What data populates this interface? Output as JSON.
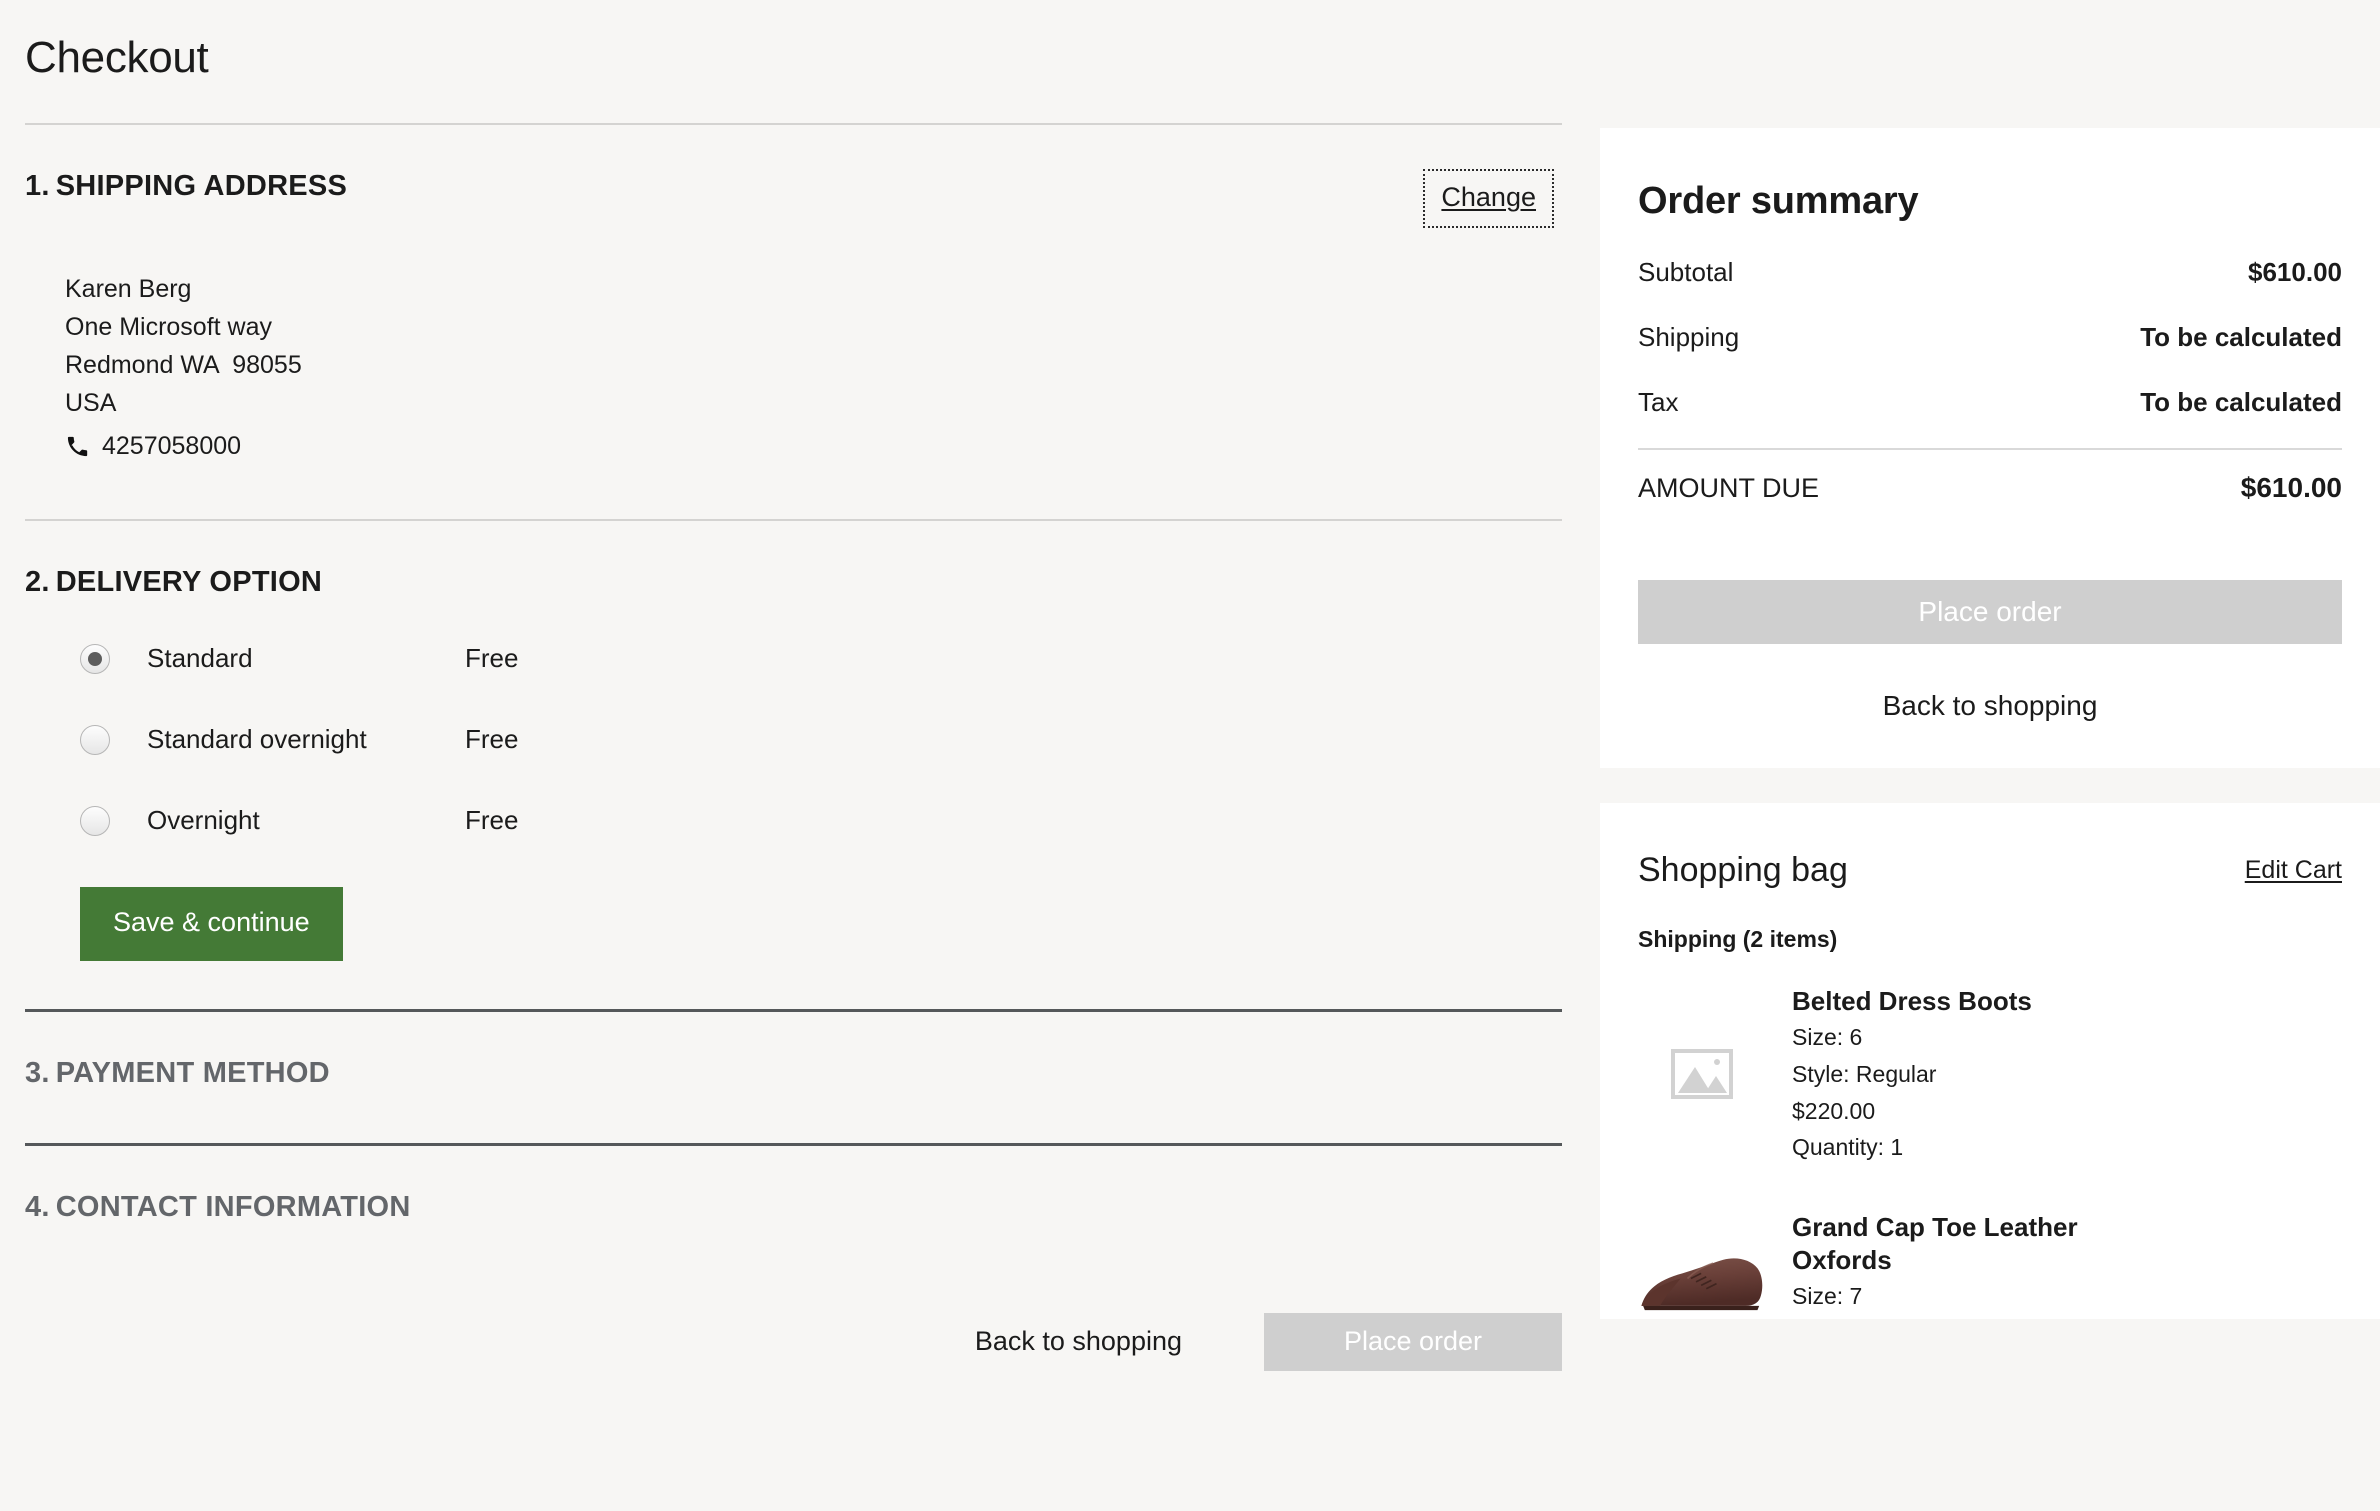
{
  "page": {
    "title": "Checkout",
    "background_color": "#f7f6f4",
    "accent_color": "#447a36",
    "disabled_color": "#cfcfcf"
  },
  "shipping_address": {
    "number": "1.",
    "heading": "SHIPPING ADDRESS",
    "change_label": "Change",
    "name": "Karen Berg",
    "street": "One Microsoft way",
    "city_state_zip": "Redmond WA  98055",
    "country": "USA",
    "phone": "4257058000",
    "phone_icon": "phone-icon"
  },
  "delivery_option": {
    "number": "2.",
    "heading": "DELIVERY OPTION",
    "options": [
      {
        "label": "Standard",
        "price": "Free",
        "selected": true
      },
      {
        "label": "Standard overnight",
        "price": "Free",
        "selected": false
      },
      {
        "label": "Overnight",
        "price": "Free",
        "selected": false
      }
    ],
    "save_label": "Save & continue"
  },
  "payment_method": {
    "number": "3.",
    "heading": "PAYMENT METHOD",
    "active": false
  },
  "contact_information": {
    "number": "4.",
    "heading": "CONTACT INFORMATION",
    "active": false
  },
  "bottom_actions": {
    "back_label": "Back to shopping",
    "place_order_label": "Place order",
    "place_order_disabled": true
  },
  "order_summary": {
    "title": "Order summary",
    "rows": [
      {
        "label": "Subtotal",
        "value": "$610.00"
      },
      {
        "label": "Shipping",
        "value": "To be calculated"
      },
      {
        "label": "Tax",
        "value": "To be calculated"
      }
    ],
    "total_label": "AMOUNT DUE",
    "total_value": "$610.00",
    "place_order_label": "Place order",
    "place_order_disabled": true,
    "back_label": "Back to shopping"
  },
  "shopping_bag": {
    "title": "Shopping bag",
    "edit_label": "Edit Cart",
    "shipping_group": "Shipping (2 items)",
    "items": [
      {
        "name": "Belted Dress Boots",
        "size": "Size: 6",
        "style": "Style: Regular",
        "price": "$220.00",
        "quantity": "Quantity: 1",
        "thumb": "image-placeholder-icon"
      },
      {
        "name": "Grand Cap Toe Leather Oxfords",
        "size": "Size: 7",
        "style": "",
        "price": "",
        "quantity": "",
        "thumb": "shoe-photo"
      }
    ]
  }
}
